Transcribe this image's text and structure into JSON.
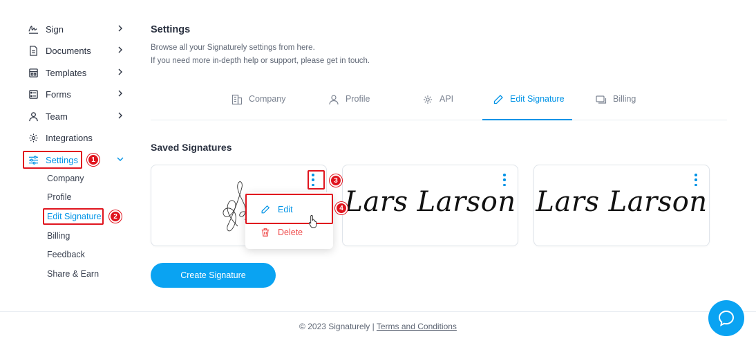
{
  "sidebar": {
    "items": [
      {
        "label": "Sign",
        "icon": "sign-icon"
      },
      {
        "label": "Documents",
        "icon": "document-icon"
      },
      {
        "label": "Templates",
        "icon": "template-icon"
      },
      {
        "label": "Forms",
        "icon": "form-icon"
      },
      {
        "label": "Team",
        "icon": "user-icon"
      },
      {
        "label": "Integrations",
        "icon": "gear-icon"
      },
      {
        "label": "Settings",
        "icon": "sliders-icon"
      }
    ],
    "subitems": [
      "Company",
      "Profile",
      "Edit Signature",
      "Billing",
      "Feedback",
      "Share & Earn"
    ]
  },
  "header": {
    "title": "Settings",
    "subtitle_line1": "Browse all your Signaturely settings from here.",
    "subtitle_line2": "If you need more in-depth help or support, please get in touch."
  },
  "tabs": [
    "Company",
    "Profile",
    "API",
    "Edit Signature",
    "Billing"
  ],
  "active_tab": "Edit Signature",
  "saved": {
    "title": "Saved Signatures",
    "signatures": [
      "Lars Larson",
      "Lars Larson"
    ]
  },
  "menu": {
    "edit_label": "Edit",
    "delete_label": "Delete"
  },
  "create_button": "Create Signature",
  "steps": [
    "1",
    "2",
    "3",
    "4"
  ],
  "footer": {
    "copyright": "© 2023 Signaturely |",
    "terms": "Terms and Conditions"
  },
  "colors": {
    "accent": "#0093e6",
    "button": "#0aa3f2",
    "danger": "#ef4a4a",
    "annotation": "#e0141e"
  }
}
